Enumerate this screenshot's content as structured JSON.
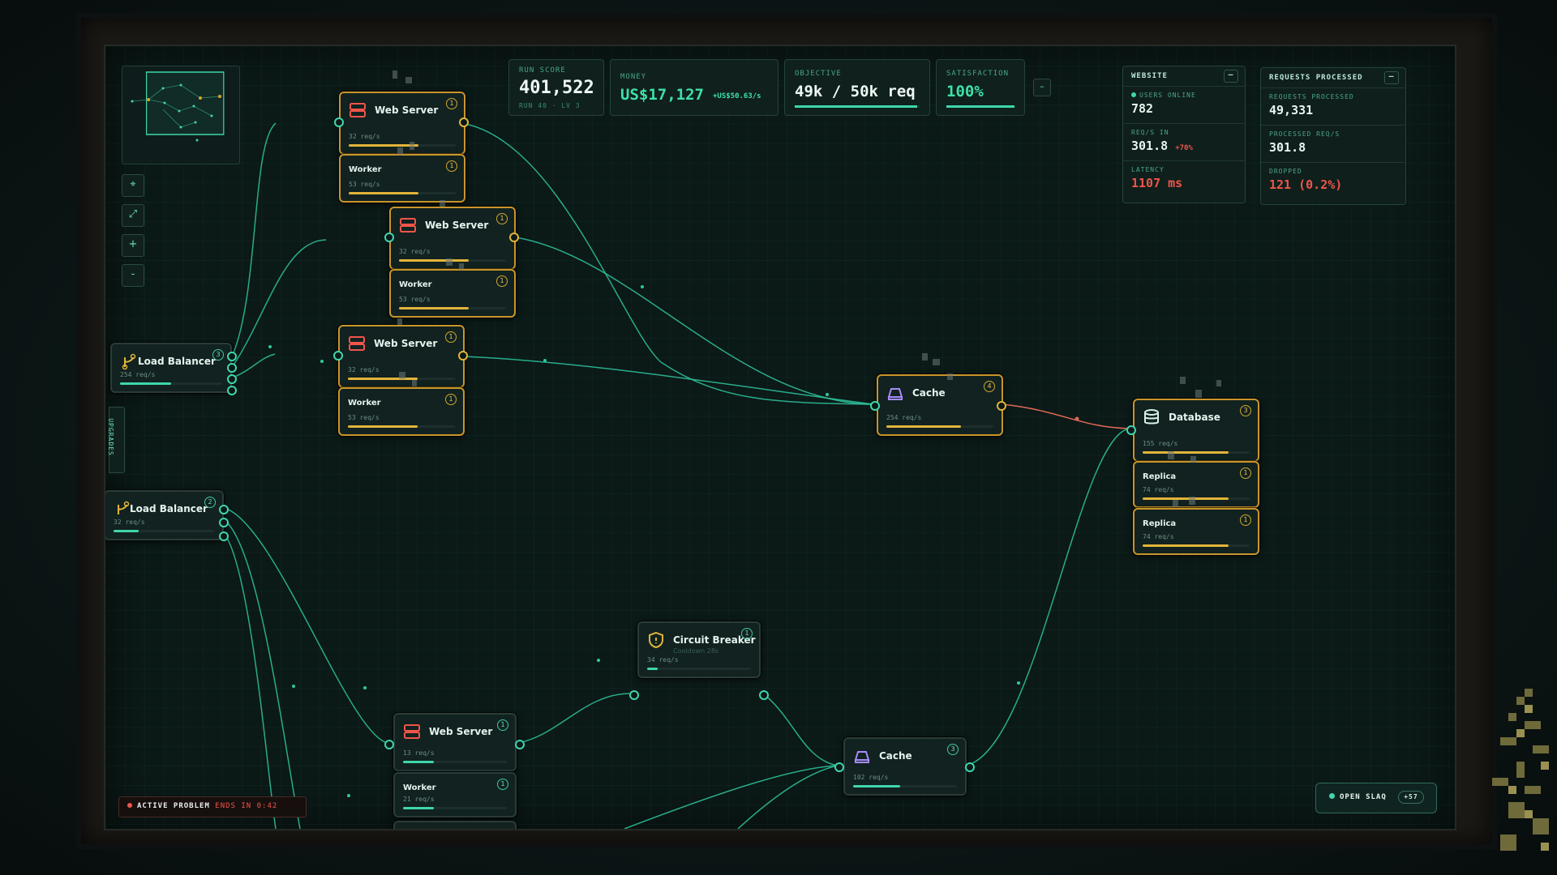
{
  "hud": {
    "run_score_label": "RUN SCORE",
    "run_score": "401,522",
    "run_meta": "RUN 40 · LV 3",
    "money_label": "MONEY",
    "money": "US$17,127",
    "money_rate": "+US$50.63/s",
    "objective_label": "OBJECTIVE",
    "objective": "49k / 50k req",
    "objective_progress": 0.98,
    "satisfaction_label": "SATISFACTION",
    "satisfaction": "100%",
    "satisfaction_progress": 1.0,
    "collapse": "–"
  },
  "website_panel": {
    "title": "WEBSITE",
    "collapse": "–",
    "users_online_label": "USERS ONLINE",
    "users_online": "782",
    "reqs_in_label": "REQ/S IN",
    "reqs_in": "301.8",
    "reqs_in_delta": "+70%",
    "latency_label": "LATENCY",
    "latency": "1107 ms"
  },
  "requests_panel": {
    "title": "REQUESTS PROCESSED",
    "collapse": "–",
    "processed_label": "REQUESTS PROCESSED",
    "processed": "49,331",
    "processed_rate_label": "PROCESSED REQ/S",
    "processed_rate": "301.8",
    "dropped_label": "DROPPED",
    "dropped": "121 (0.2%)"
  },
  "toolbar": {
    "center": "⌖",
    "fit": "⤢",
    "zoom_in": "+",
    "zoom_out": "-",
    "upgrades": "UPGRADES"
  },
  "nodes": {
    "lb1": {
      "title": "Load Balancer",
      "rate": "254 req/s",
      "badge": "3",
      "load": 0.5
    },
    "lb2": {
      "title": "Load Balancer",
      "rate": "32 req/s",
      "badge": "2",
      "load": 0.25
    },
    "ws1": {
      "title": "Web Server",
      "rate": "32 req/s",
      "badge": "1",
      "load": 0.65
    },
    "wk1": {
      "title": "Worker",
      "rate": "53 req/s",
      "badge": "1",
      "load": 0.65
    },
    "ws2": {
      "title": "Web Server",
      "rate": "32 req/s",
      "badge": "1",
      "load": 0.65
    },
    "wk2": {
      "title": "Worker",
      "rate": "53 req/s",
      "badge": "1",
      "load": 0.65
    },
    "ws3": {
      "title": "Web Server",
      "rate": "32 req/s",
      "badge": "1",
      "load": 0.65
    },
    "wk3": {
      "title": "Worker",
      "rate": "53 req/s",
      "badge": "1",
      "load": 0.65
    },
    "cache1": {
      "title": "Cache",
      "rate": "254 req/s",
      "badge": "4",
      "load": 0.7
    },
    "db": {
      "title": "Database",
      "rate": "155 req/s",
      "badge": "3",
      "load": 0.8
    },
    "rep1": {
      "title": "Replica",
      "rate": "74 req/s",
      "badge": "1",
      "load": 0.8
    },
    "rep2": {
      "title": "Replica",
      "rate": "74 req/s",
      "badge": "1",
      "load": 0.8
    },
    "cb": {
      "title": "Circuit Breaker",
      "sub": "Cooldown 28s",
      "rate": "34 req/s",
      "badge": "1",
      "load": 0.1
    },
    "ws4": {
      "title": "Web Server",
      "rate": "13 req/s",
      "badge": "1",
      "load": 0.3
    },
    "wk4": {
      "title": "Worker",
      "rate": "21 req/s",
      "badge": "1",
      "load": 0.3
    },
    "cache2": {
      "title": "Cache",
      "rate": "102 req/s",
      "badge": "3",
      "load": 0.45
    }
  },
  "problem": {
    "label": "ACTIVE PROBLEM",
    "timer": "ENDS IN 0:42"
  },
  "slaq": {
    "label": "OPEN SLAQ",
    "count": "+57"
  },
  "colors": {
    "accent": "#3fd6ad",
    "gold": "#e2b43a",
    "danger": "#f0554a"
  }
}
